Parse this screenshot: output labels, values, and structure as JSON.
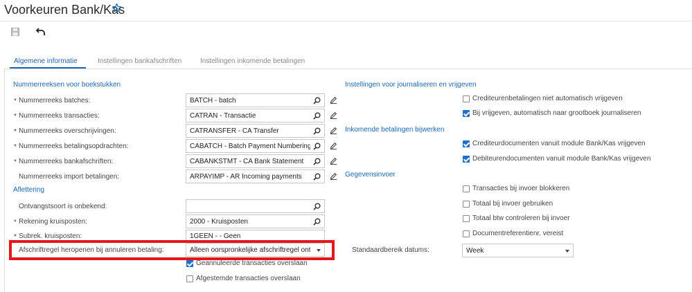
{
  "page": {
    "title": "Voorkeuren Bank/Kas"
  },
  "tabs": [
    {
      "label": "Algemene informatie",
      "active": true
    },
    {
      "label": "Instellingen bankafschriften",
      "active": false
    },
    {
      "label": "Instellingen inkomende betalingen",
      "active": false
    }
  ],
  "left": {
    "section_numbering": "Nummerreeksen voor boekstukken",
    "required_mark": "*",
    "rows": [
      {
        "label": "Nummerreeks batches:",
        "value": "BATCH - batch"
      },
      {
        "label": "Nummerreeks transacties:",
        "value": "CATRAN - Transactie"
      },
      {
        "label": "Nummerreeks overschrijvingen:",
        "value": "CATRANSFER - CA Transfer"
      },
      {
        "label": "Nummerreeks betalingsopdrachten:",
        "value": "CABATCH - Batch Payment Numbering"
      },
      {
        "label": "Nummerreeks bankafschriften:",
        "value": "CABANKSTMT - CA Bank Statement"
      },
      {
        "label": "Nummerreeks import betalingen:",
        "value": "ARPAYIMP - AR Incoming payments"
      }
    ],
    "section_matching": "Aflettering",
    "matching_rows": [
      {
        "label": "Ontvangstsoort is onbekend:",
        "value": ""
      },
      {
        "label": "Rekening kruisposten:",
        "value": "2000 - Kruisposten"
      },
      {
        "label": "Subrek. kruisposten:",
        "value": "1GEEN - - Geen"
      }
    ],
    "reopen": {
      "label": "Afschriftregel heropenen bij annuleren betaling:",
      "value": "Alleen oorspronkelijke afschriftregel ontkoppelen"
    },
    "checks": [
      {
        "label": "Geannuleerde transacties overslaan",
        "checked": true
      },
      {
        "label": "Afgestemde transacties overslaan",
        "checked": false
      }
    ]
  },
  "right": {
    "section_journal": "Instellingen voor journaliseren en vrijgeven",
    "journal_checks": [
      {
        "label": "Crediteurenbetalingen niet automatisch vrijgeven",
        "checked": false
      },
      {
        "label": "Bij vrijgeven, automatisch naar grootboek journaliseren",
        "checked": true
      }
    ],
    "section_incoming": "Inkomende betalingen bijwerken",
    "incoming_checks": [
      {
        "label": "Crediteurdocumenten vanuit module Bank/Kas vrijgeven",
        "checked": true
      },
      {
        "label": "Debiteurendocumenten vanuit module Bank/Kas vrijgeven",
        "checked": true
      }
    ],
    "section_entry": "Gegevensinvoer",
    "entry_checks": [
      {
        "label": "Transacties bij invoer blokkeren",
        "checked": false
      },
      {
        "label": "Totaal bij invoer gebruiken",
        "checked": false
      },
      {
        "label": "Totaal btw controleren bij invoer",
        "checked": false
      },
      {
        "label": "Documentreferentienr. vereist",
        "checked": false
      }
    ],
    "date_range": {
      "label": "Standaardbereik datums:",
      "value": "Week"
    }
  },
  "colors": {
    "accent": "#1b67b6",
    "highlight": "#e8141b",
    "checkbox": "#1e6fc7"
  },
  "icons": [
    "star-icon",
    "save-icon",
    "undo-icon",
    "search-icon",
    "pencil-icon",
    "chevron-down-icon"
  ]
}
